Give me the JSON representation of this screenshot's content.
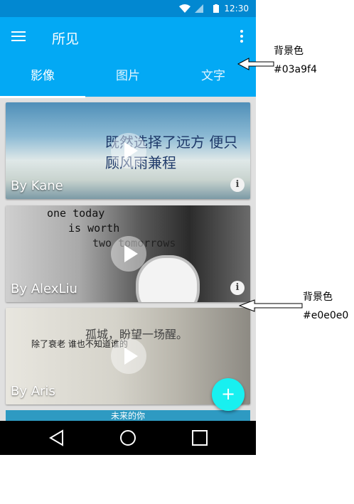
{
  "status_bar": {
    "time": "12:30"
  },
  "app_bar": {
    "title": "所见"
  },
  "tabs": [
    {
      "label": "影像",
      "active": true
    },
    {
      "label": "图片",
      "active": false
    },
    {
      "label": "文字",
      "active": false
    }
  ],
  "cards": [
    {
      "author": "By Kane",
      "overlay_text": "既然选择了远方 便只顾风雨兼程"
    },
    {
      "author": "By AlexLiu",
      "overlay_lines": [
        "one today",
        "is worth",
        "two tomorrows"
      ]
    },
    {
      "author": "By Aris",
      "overlay_lines": [
        "孤城，盼望一场醒。",
        "除了衰老 谁也不知道谁的"
      ]
    },
    {
      "caption": "未来的你"
    }
  ],
  "fab": {
    "symbol": "+"
  },
  "annotations": {
    "appbar_label": "背景色",
    "appbar_color": "#03a9f4",
    "content_label": "背景色",
    "content_color": "#e0e0e0"
  },
  "colors": {
    "primary": "#03a9f4",
    "status_bar": "#0288d1",
    "background": "#e0e0e0",
    "accent": "#18f0f0"
  }
}
